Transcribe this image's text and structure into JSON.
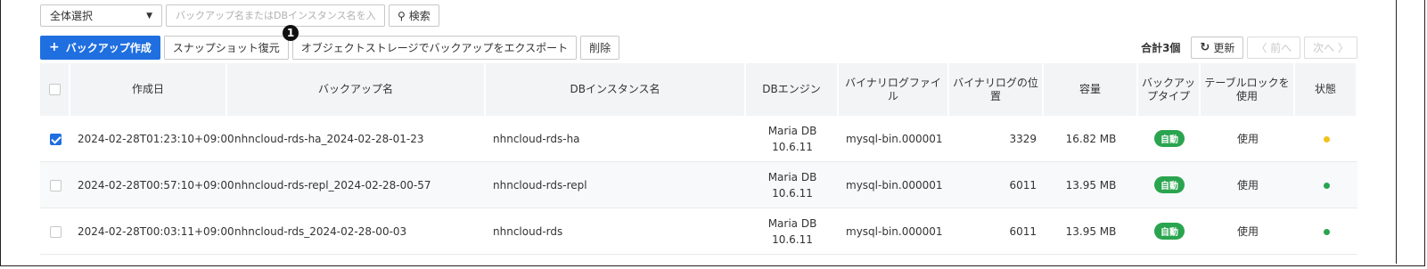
{
  "toolbar": {
    "filter_value": "全体選択",
    "search_placeholder": "バックアップ名またはDBインスタンス名を入力",
    "search_label": "検索",
    "create_label": "バックアップ作成",
    "snapshot_restore_label": "スナップショット復元",
    "export_label": "オブジェクトストレージでバックアップをエクスポート",
    "delete_label": "削除",
    "callout_number": "1",
    "total_label": "合計3個",
    "refresh_label": "更新",
    "prev_label": "〈 前へ",
    "next_label": "次へ 〉"
  },
  "table": {
    "headers": {
      "created": "作成日",
      "backup_name": "バックアップ名",
      "instance_name": "DBインスタンス名",
      "engine": "DBエンジン",
      "binlog_file": "バイナリログファイル",
      "binlog_position": "バイナリログの位置",
      "size": "容量",
      "backup_type": "バックアップタイプ",
      "table_lock": "テーブルロックを使用",
      "status": "状態"
    },
    "rows": [
      {
        "checked": true,
        "created": "2024-02-28T01:23:10+09:00",
        "backup_name": "nhncloud-rds-ha_2024-02-28-01-23",
        "instance_name": "nhncloud-rds-ha",
        "engine": "Maria DB 10.6.11",
        "binlog_file": "mysql-bin.000001",
        "binlog_position": "3329",
        "size": "16.82 MB",
        "backup_type": "自動",
        "table_lock": "使用",
        "status_color": "#f2c21b"
      },
      {
        "checked": false,
        "created": "2024-02-28T00:57:10+09:00",
        "backup_name": "nhncloud-rds-repl_2024-02-28-00-57",
        "instance_name": "nhncloud-rds-repl",
        "engine": "Maria DB 10.6.11",
        "binlog_file": "mysql-bin.000001",
        "binlog_position": "6011",
        "size": "13.95 MB",
        "backup_type": "自動",
        "table_lock": "使用",
        "status_color": "#2aa44f"
      },
      {
        "checked": false,
        "created": "2024-02-28T00:03:11+09:00",
        "backup_name": "nhncloud-rds_2024-02-28-00-03",
        "instance_name": "nhncloud-rds",
        "engine": "Maria DB 10.6.11",
        "binlog_file": "mysql-bin.000001",
        "binlog_position": "6011",
        "size": "13.95 MB",
        "backup_type": "自動",
        "table_lock": "使用",
        "status_color": "#2aa44f"
      }
    ]
  }
}
